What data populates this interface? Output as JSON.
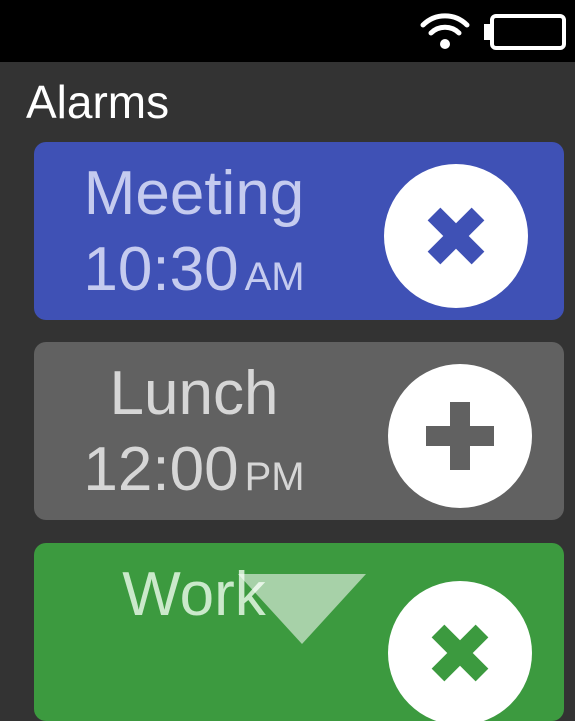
{
  "status": {
    "wifi_icon": "wifi-icon",
    "battery_icon": "battery-icon"
  },
  "page": {
    "title": "Alarms"
  },
  "alarms": [
    {
      "name": "Meeting",
      "time": "10:30",
      "ampm": "AM",
      "color": "#3f51b5",
      "text_color": "#c5cbef",
      "action_icon": "close-icon"
    },
    {
      "name": "Lunch",
      "time": "12:00",
      "ampm": "PM",
      "color": "#616161",
      "text_color": "#d6d6d6",
      "action_icon": "plus-icon"
    },
    {
      "name": "Work",
      "color": "#3c9a3f",
      "text_color": "#cbe9cb",
      "action_icon": "close-icon"
    }
  ],
  "scroll_indicator_icon": "scroll-down-arrow-icon"
}
